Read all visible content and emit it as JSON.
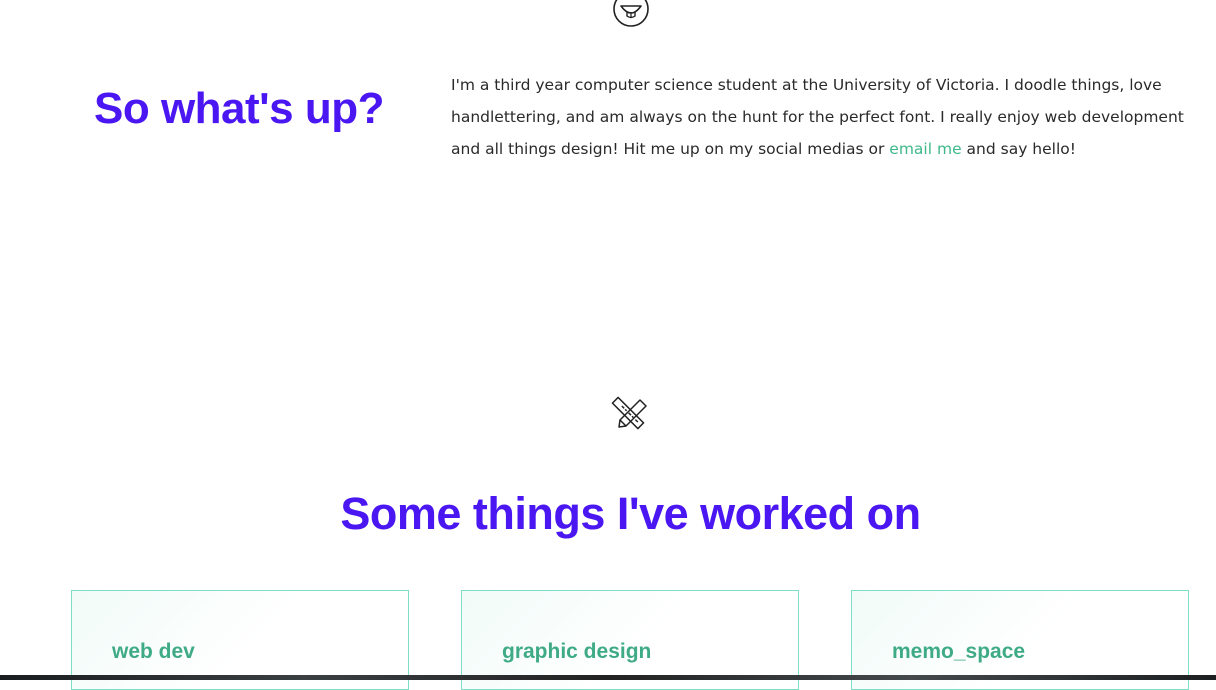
{
  "about": {
    "title": "So what's up?",
    "text_before_link": "I'm a third year computer science student at the University of Victoria. I doodle things, love handlettering, and am always on the hunt for the perfect font. I really enjoy web development and all things design! Hit me up on my social medias or ",
    "link_label": "email me",
    "text_after_link": " and say hello!",
    "icon": "smiley-face-icon"
  },
  "work": {
    "title": "Some things I've worked on",
    "icon": "pencil-ruler-icon",
    "cards": [
      {
        "label": "web dev"
      },
      {
        "label": "graphic design"
      },
      {
        "label": "memo_space"
      }
    ]
  },
  "colors": {
    "heading": "#4a17f3",
    "accent_green": "#3fb98b",
    "card_border": "#7fdfc4",
    "body_text": "#2a2a2a"
  }
}
